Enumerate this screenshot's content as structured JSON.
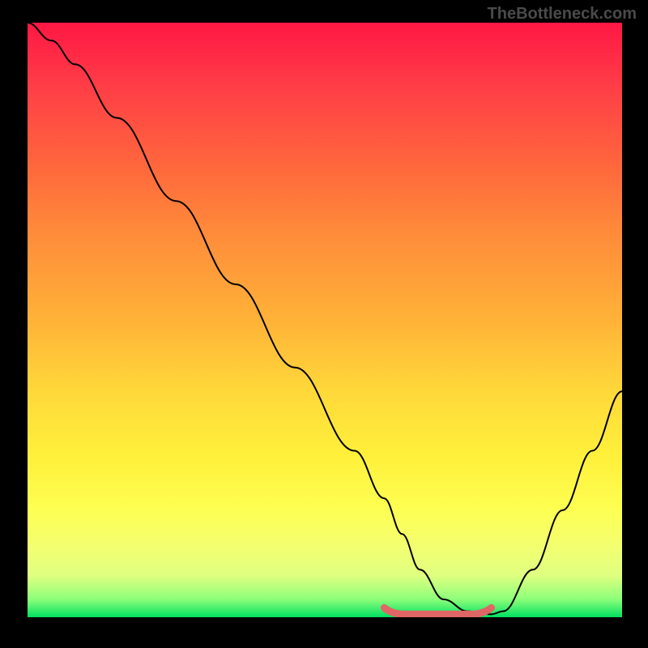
{
  "watermark": "TheBottleneck.com",
  "chart_data": {
    "type": "line",
    "title": "",
    "xlabel": "",
    "ylabel": "",
    "xlim": [
      0,
      100
    ],
    "ylim": [
      0,
      100
    ],
    "grid": false,
    "legend": false,
    "series": [
      {
        "name": "curve",
        "x": [
          0,
          4,
          8,
          15,
          25,
          35,
          45,
          55,
          60,
          63,
          66,
          70,
          74,
          78,
          80,
          85,
          90,
          95,
          100
        ],
        "y": [
          100,
          97,
          93,
          84,
          70,
          56,
          42,
          28,
          20,
          14,
          8,
          3,
          1,
          0.5,
          1,
          8,
          18,
          28,
          38
        ]
      }
    ],
    "highlight": {
      "name": "minimum-band",
      "x_range": [
        60,
        78
      ],
      "y": 0.5,
      "color": "#e06666"
    },
    "background_gradient": {
      "top": "#ff1744",
      "bottom": "#00e061"
    }
  }
}
